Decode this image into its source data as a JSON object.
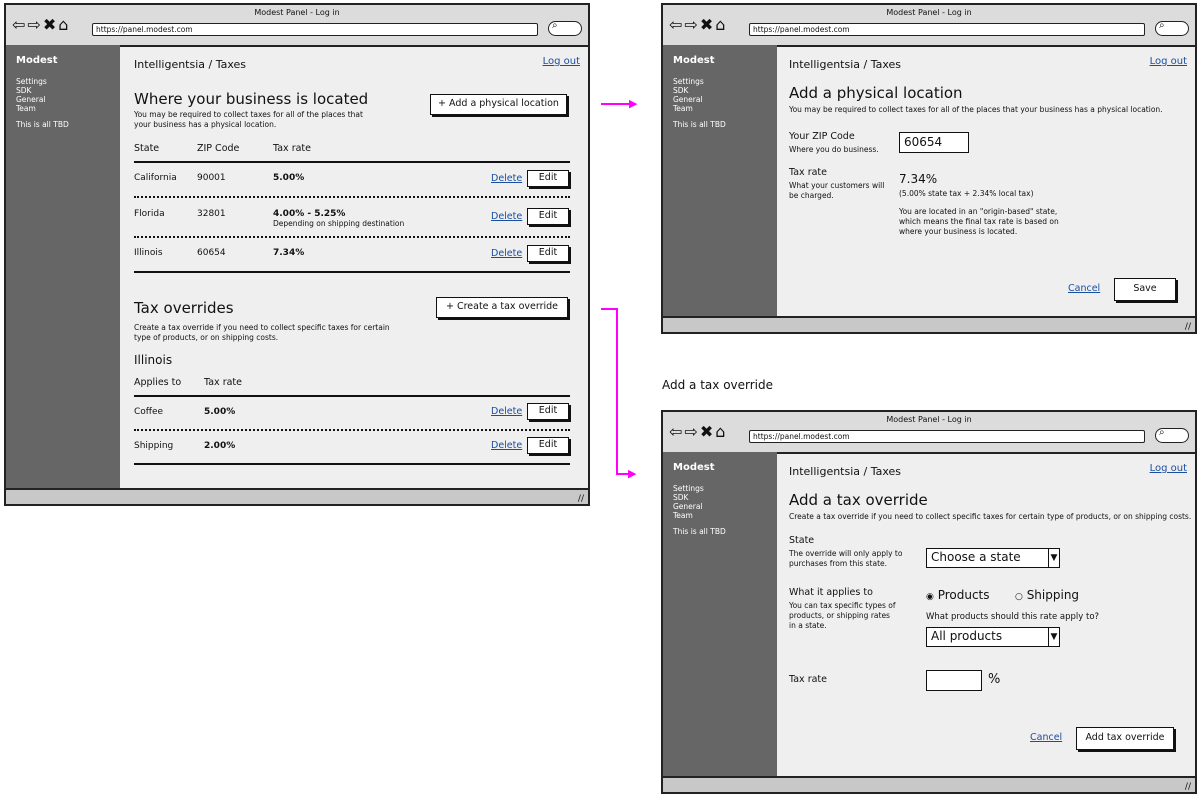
{
  "window": {
    "title": "Modest Panel - Log in",
    "url": "https://panel.modest.com"
  },
  "sidebar": {
    "brand": "Modest",
    "items": [
      {
        "label": "Settings"
      },
      {
        "label": "SDK"
      },
      {
        "label": "General"
      },
      {
        "label": "Team"
      }
    ],
    "note": "This is all TBD"
  },
  "header": {
    "breadcrumb": "Intelligentsia / Taxes",
    "logout": "Log out"
  },
  "taxes_page": {
    "location_title": "Where your business is located",
    "location_desc": "You may be required to collect taxes for all of the places that your business has a physical location.",
    "add_location_button": "+ Add a physical location",
    "columns": [
      "State",
      "ZIP Code",
      "Tax rate"
    ],
    "rows": [
      {
        "state": "California",
        "zip": "90001",
        "rate": "5.00%",
        "note": ""
      },
      {
        "state": "Florida",
        "zip": "32801",
        "rate": "4.00% - 5.25%",
        "note": "Depending on shipping destination"
      },
      {
        "state": "Illinois",
        "zip": "60654",
        "rate": "7.34%",
        "note": ""
      }
    ],
    "delete_label": "Delete",
    "edit_label": "Edit",
    "overrides_title": "Tax overrides",
    "overrides_desc": "Create a tax override if you need to collect specific taxes for certain type of products, or on shipping costs.",
    "create_override_button": "+ Create a tax override",
    "override_state": "Illinois",
    "override_columns": [
      "Applies to",
      "Tax rate"
    ],
    "override_rows": [
      {
        "applies": "Coffee",
        "rate": "5.00%"
      },
      {
        "applies": "Shipping",
        "rate": "2.00%"
      }
    ]
  },
  "add_location_page": {
    "title": "Add a physical location",
    "desc": "You may be required to collect taxes for all of the places that your business has a physical location.",
    "zip_label": "Your ZIP Code",
    "zip_help": "Where you do business.",
    "zip_value": "60654",
    "rate_label": "Tax rate",
    "rate_help": "What your customers will be charged.",
    "rate_value": "7.34%",
    "rate_breakdown": "(5.00% state tax + 2.34% local tax)",
    "rate_note": "You are located in an \"origin-based\" state, which means the final tax rate is based on where your business is located.",
    "cancel": "Cancel",
    "save": "Save"
  },
  "annotation": "Add a tax override",
  "add_override_page": {
    "title": "Add a tax override",
    "desc": "Create a tax override if you need to collect specific taxes for certain type of products, or on shipping costs.",
    "state_label": "State",
    "state_help": "The override will only apply to purchases from this state.",
    "state_select": "Choose a state",
    "applies_label": "What it applies to",
    "applies_help": "You can tax specific types of products, or shipping rates in a state.",
    "radio_products": "Products",
    "radio_shipping": "Shipping",
    "products_question": "What products should this rate apply to?",
    "products_select": "All products",
    "rate_label": "Tax rate",
    "percent": "%",
    "cancel": "Cancel",
    "submit": "Add tax override"
  },
  "colors": {
    "sidebar": "#666666",
    "link": "#1a4ea0",
    "arrow": "#ff00ff"
  }
}
